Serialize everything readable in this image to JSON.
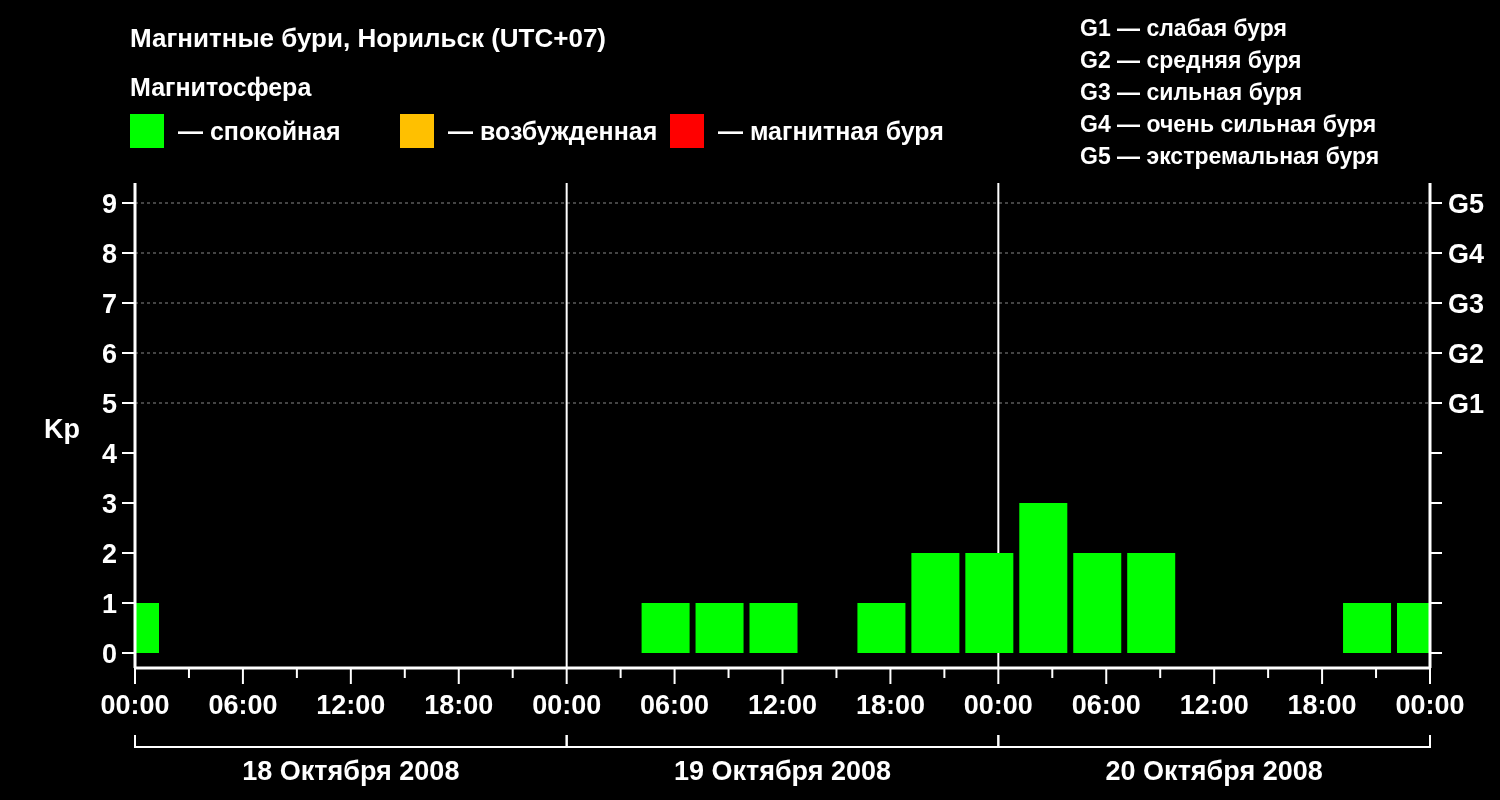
{
  "title": "Магнитные бури, Норильск (UTC+07)",
  "legend": {
    "heading": "Магнитосфера",
    "items": [
      {
        "color": "#00ff00",
        "label": "— спокойная"
      },
      {
        "color": "#ffc000",
        "label": "— возбужденная"
      },
      {
        "color": "#ff0000",
        "label": "— магнитная буря"
      }
    ]
  },
  "storm_scale": [
    "G1 — слабая буря",
    "G2 — средняя буря",
    "G3 — сильная буря",
    "G4 — очень сильная буря",
    "G5 — экстремальная буря"
  ],
  "chart": {
    "scale_ticks": [
      "G5",
      "G4",
      "G3",
      "G2",
      "G1"
    ],
    "days": [
      "18 Октября 2008",
      "19 Октября 2008",
      "20 Октября 2008"
    ],
    "chart_data": {
      "type": "bar",
      "ylabel": "Kp",
      "grid": true,
      "x": [
        "2008-10-18T00:00",
        "2008-10-18T02:30",
        "2008-10-18T05:30",
        "2008-10-18T08:30",
        "2008-10-18T11:30",
        "2008-10-18T14:30",
        "2008-10-18T17:30",
        "2008-10-18T20:30",
        "2008-10-18T23:30",
        "2008-10-19T02:30",
        "2008-10-19T05:30",
        "2008-10-19T08:30",
        "2008-10-19T11:30",
        "2008-10-19T14:30",
        "2008-10-19T17:30",
        "2008-10-19T20:30",
        "2008-10-19T23:30",
        "2008-10-20T02:30",
        "2008-10-20T05:30",
        "2008-10-20T08:30",
        "2008-10-20T11:30",
        "2008-10-20T14:30",
        "2008-10-20T17:30",
        "2008-10-20T20:30",
        "2008-10-20T23:30"
      ],
      "series": [
        {
          "color": "#00ff00",
          "values": [
            1,
            0,
            0,
            0,
            0,
            0,
            0,
            0,
            0,
            0,
            1,
            1,
            1,
            0,
            1,
            2,
            2,
            3,
            2,
            2,
            0,
            0,
            0,
            1,
            1
          ]
        }
      ],
      "xlim": [
        "2008-10-18T00:00",
        "2008-10-21T00:00"
      ],
      "ylim": [
        -0.3,
        9.4
      ],
      "xticks": [
        {
          "value": "2008-10-18T00:00",
          "label": "00:00"
        },
        {
          "value": "2008-10-18T06:00",
          "label": "06:00"
        },
        {
          "value": "2008-10-18T12:00",
          "label": "12:00"
        },
        {
          "value": "2008-10-18T18:00",
          "label": "18:00"
        },
        {
          "value": "2008-10-19T00:00",
          "label": "00:00"
        },
        {
          "value": "2008-10-19T06:00",
          "label": "06:00"
        },
        {
          "value": "2008-10-19T12:00",
          "label": "12:00"
        },
        {
          "value": "2008-10-19T18:00",
          "label": "18:00"
        },
        {
          "value": "2008-10-20T00:00",
          "label": "00:00"
        },
        {
          "value": "2008-10-20T06:00",
          "label": "06:00"
        },
        {
          "value": "2008-10-20T12:00",
          "label": "12:00"
        },
        {
          "value": "2008-10-20T18:00",
          "label": "18:00"
        },
        {
          "value": "2008-10-21T00:00",
          "label": "00:00"
        }
      ],
      "yticks": [
        0,
        1,
        2,
        3,
        4,
        5,
        6,
        7,
        8,
        9
      ]
    }
  }
}
